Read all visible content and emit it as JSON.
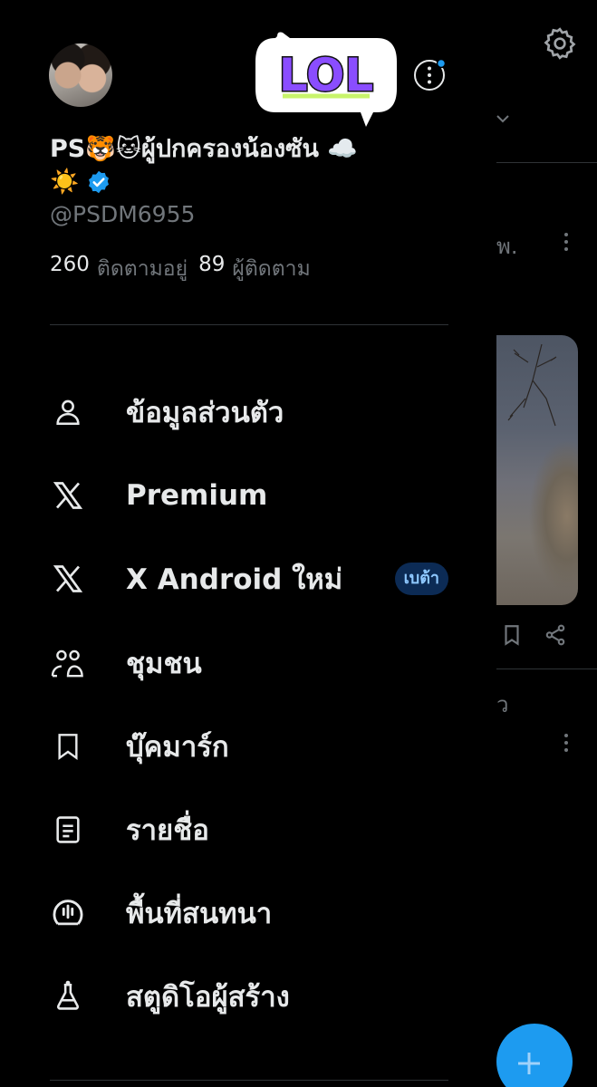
{
  "profile": {
    "display_name": "PS🐯🐱ผู้ปกครองน้องซัน ☁️",
    "name_emoji_line": "☀️",
    "handle": "@PSDM6955",
    "following_count": "260",
    "following_label": "ติดตามอยู่",
    "followers_count": "89",
    "followers_label": "ผู้ติดตาม",
    "sticker_text": "LOL"
  },
  "menu": {
    "items": [
      {
        "label": "ข้อมูลส่วนตัว",
        "icon": "person-icon"
      },
      {
        "label": "Premium",
        "icon": "x-logo-icon"
      },
      {
        "label": "X Android ใหม่",
        "icon": "x-logo-icon",
        "badge": "เบต้า"
      },
      {
        "label": "ชุมชน",
        "icon": "communities-icon"
      },
      {
        "label": "บุ๊คมาร์ก",
        "icon": "bookmark-icon"
      },
      {
        "label": "รายชื่อ",
        "icon": "list-icon"
      },
      {
        "label": "พื้นที่สนทนา",
        "icon": "spaces-icon"
      },
      {
        "label": "สตูดิโอผู้สร้าง",
        "icon": "creator-studio-icon"
      }
    ]
  },
  "timeline": {
    "snippet1": "พ.",
    "snippet2": "ว"
  },
  "colors": {
    "background": "#000000",
    "text_primary": "#e7e9ea",
    "text_secondary": "#71767b",
    "accent": "#1d9bf0",
    "badge_bg": "#0c2b55",
    "sticker_purple": "#8a4dff",
    "sticker_green": "#c8f46b"
  }
}
